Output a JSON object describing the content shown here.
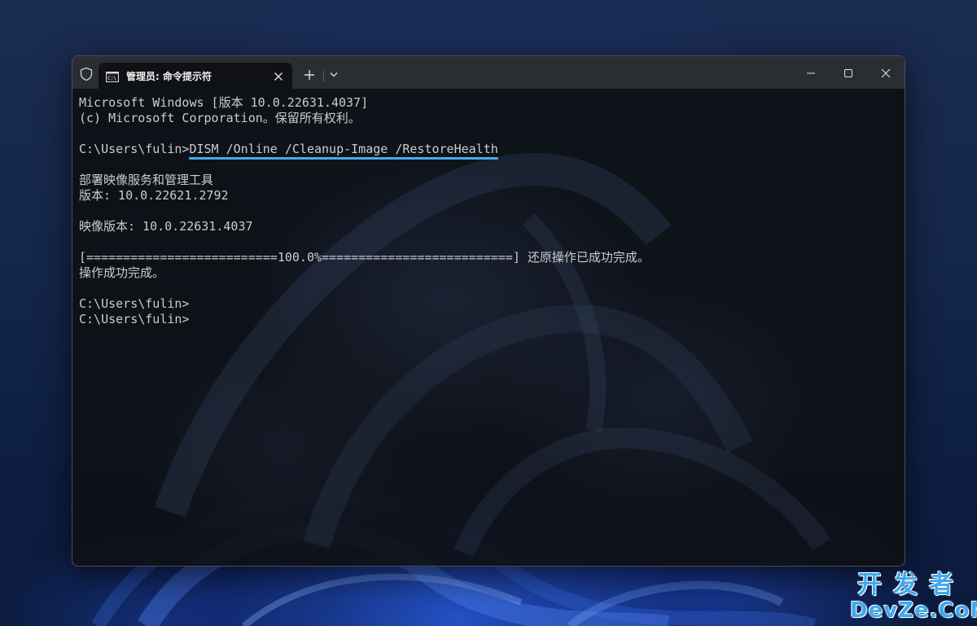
{
  "tab": {
    "title": "管理员: 命令提示符"
  },
  "terminal": {
    "lines": [
      "Microsoft Windows [版本 10.0.22631.4037]",
      "(c) Microsoft Corporation。保留所有权利。",
      "",
      "",
      "",
      "部署映像服务和管理工具",
      "版本: 10.0.22621.2792",
      "",
      "映像版本: 10.0.22631.4037",
      "",
      "[==========================100.0%==========================] 还原操作已成功完成。",
      "操作成功完成。",
      "",
      "C:\\Users\\fulin>",
      "C:\\Users\\fulin>"
    ],
    "command_prompt": "C:\\Users\\fulin>",
    "command": "DISM /Online /Cleanup-Image /RestoreHealth"
  },
  "watermark": {
    "cn": "开发者",
    "en": "DevZe.CoM"
  },
  "colors": {
    "highlight": "#4aa8ec",
    "terminal_text": "#cccccc",
    "titlebar": "#2a2d32"
  },
  "icons": [
    "shield-icon",
    "cmd-icon",
    "close-icon",
    "plus-icon",
    "chevron-down-icon",
    "minimize-icon",
    "maximize-icon",
    "close-window-icon"
  ]
}
